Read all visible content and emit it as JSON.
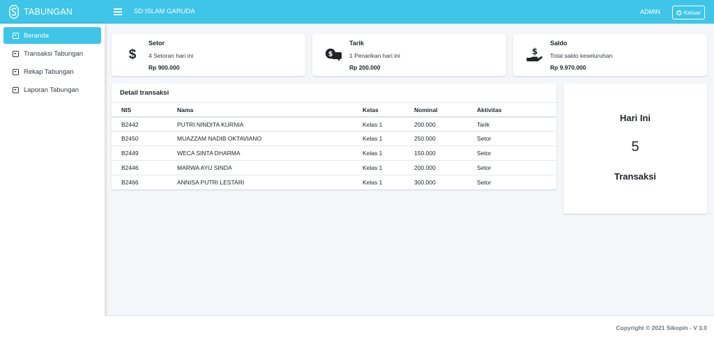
{
  "app": {
    "brand": "TABUNGAN",
    "school": "SD ISLAM GARUDA",
    "user": "ADMIN",
    "logout_label": "Keluar",
    "accent": "#3ec5e8"
  },
  "sidebar": {
    "items": [
      {
        "label": "Beranda",
        "active": true
      },
      {
        "label": "Transaksi Tabungan",
        "active": false
      },
      {
        "label": "Rekap Tabungan",
        "active": false
      },
      {
        "label": "Laporan Tabungan",
        "active": false
      }
    ]
  },
  "infoboxes": [
    {
      "icon": "dollar-icon",
      "title": "Setor",
      "desc": "4 Setoran hari ini",
      "amount": "Rp 900.000"
    },
    {
      "icon": "money-chat-icon",
      "title": "Tarik",
      "desc": "1 Penarikan hari ini",
      "amount": "Rp 200.000"
    },
    {
      "icon": "hand-holding-dollar-icon",
      "title": "Saldo",
      "desc": "Total saldo keseluruhan",
      "amount": "Rp 9.970.000"
    }
  ],
  "transactions": {
    "title": "Detail transaksi",
    "headers": [
      "NIS",
      "Nama",
      "Kelas",
      "Nominal",
      "Aktivitas"
    ],
    "rows": [
      [
        "B2442",
        "PUTRI NINDITA KURNIA",
        "Kelas 1",
        "200.000",
        "Tarik"
      ],
      [
        "B2450",
        "MUAZZAM NADIB OKTAVIANO",
        "Kelas 1",
        "250.000",
        "Setor"
      ],
      [
        "B2449",
        "WECA SINTA DHARMA",
        "Kelas 1",
        "150.000",
        "Setor"
      ],
      [
        "B2446",
        "MARWA AYU SINDA",
        "Kelas 1",
        "200.000",
        "Setor"
      ],
      [
        "B2466",
        "ANNISA PUTRI LESTARI",
        "Kelas 1",
        "300.000",
        "Setor"
      ]
    ]
  },
  "summary": {
    "line1": "Hari Ini",
    "count": "5",
    "line3": "Transaksi"
  },
  "footer": {
    "text": "Copyright © 2021 Sikopin - V 3.0"
  }
}
